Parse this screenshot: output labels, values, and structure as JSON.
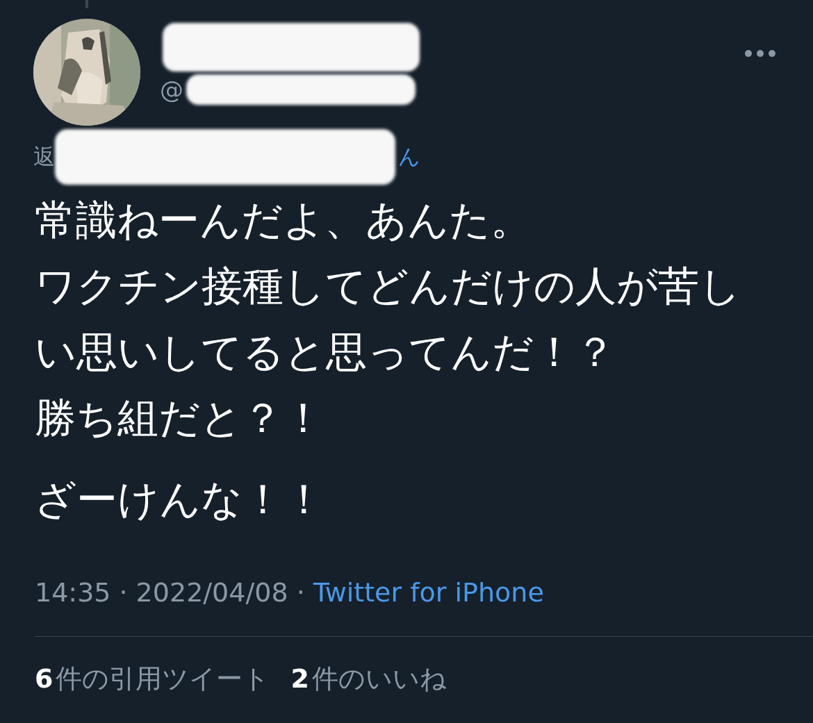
{
  "tweet": {
    "handle_prefix": "@",
    "reply_prefix": "返",
    "reply_suffix": "ん",
    "body": [
      [
        "常識ねーんだよ、あんた。",
        "ワクチン接種してどんだけの人が苦しい思いしてると思ってんだ！？",
        "勝ち組だと？！"
      ],
      [
        "ざーけんな！！"
      ]
    ],
    "time": "14:35",
    "date": "2022/04/08",
    "separator": "·",
    "source": "Twitter for iPhone",
    "stats": [
      {
        "count": "6",
        "label": "件の引用ツイート"
      },
      {
        "count": "2",
        "label": "件のいいね"
      }
    ]
  }
}
